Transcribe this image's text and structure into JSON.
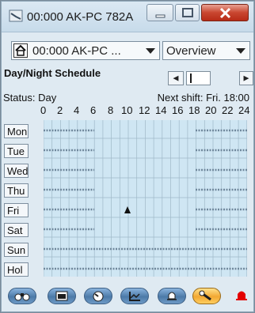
{
  "window": {
    "title": "00:000 AK-PC 782A",
    "colors": {
      "titlebar": "#c7dbea",
      "close": "#c9462f",
      "accent": "#f2a832"
    }
  },
  "toolbar": {
    "station_combo_value": "00:000 AK-PC ...",
    "view_combo_value": "Overview"
  },
  "schedule": {
    "label": "Day/Night Schedule",
    "status": "Status: Day",
    "next_shift": "Next shift: Fri. 18:00",
    "hours": [
      "0",
      "2",
      "4",
      "6",
      "8",
      "10",
      "12",
      "14",
      "16",
      "18",
      "20",
      "22",
      "24"
    ],
    "days": [
      "Mon",
      "Tue",
      "Wed",
      "Thu",
      "Fri",
      "Sat",
      "Sun",
      "Hol"
    ],
    "night_periods": "00:00–06:00 and 18:00–24:00 Mon–Sat; 00:00–24:00 Sun and Hol",
    "day_periods": "06:00–18:00 Mon–Sat",
    "current_time": "Fri 10:00"
  },
  "bottom_nav": {
    "buttons": [
      "binoculars-icon",
      "calendar-icon",
      "dial-icon",
      "graph-icon",
      "bell-icon",
      "wrench-icon"
    ],
    "active": "wrench-icon",
    "alarm_icon": "red-bell-icon"
  }
}
